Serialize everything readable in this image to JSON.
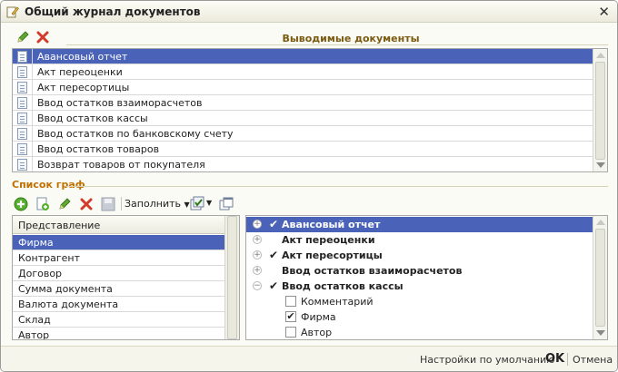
{
  "window": {
    "title": "Общий журнал документов",
    "close_glyph": "✕"
  },
  "docs": {
    "caption": "Выводимые документы",
    "items": [
      {
        "label": "Авансовый отчет",
        "selected": true
      },
      {
        "label": "Акт переоценки"
      },
      {
        "label": "Акт пересортицы"
      },
      {
        "label": "Ввод остатков взаиморасчетов"
      },
      {
        "label": "Ввод остатков кассы"
      },
      {
        "label": "Ввод остатков по банковскому счету"
      },
      {
        "label": "Ввод остатков товаров"
      },
      {
        "label": "Возврат товаров от покупателя"
      }
    ]
  },
  "columns": {
    "caption": "Список граф",
    "fill_label": "Заполнить",
    "fields_header": "Представление",
    "fields": [
      "Фирма",
      "Контрагент",
      "Договор",
      "Сумма документа",
      "Валюта документа",
      "Склад",
      "Автор"
    ],
    "tree": [
      {
        "label": "Авансовый отчет",
        "expander": "+",
        "checked": true,
        "selected": true
      },
      {
        "label": "Акт переоценки",
        "expander": "+",
        "checked": false
      },
      {
        "label": "Акт пересортицы",
        "expander": "+",
        "checked": true
      },
      {
        "label": "Ввод остатков взаиморасчетов",
        "expander": "+",
        "checked": false
      },
      {
        "label": "Ввод остатков кассы",
        "expander": "−",
        "checked": true
      },
      {
        "label": "Комментарий",
        "child": true,
        "checked": false
      },
      {
        "label": "Фирма",
        "child": true,
        "checked": true
      },
      {
        "label": "Автор",
        "child": true,
        "checked": false
      }
    ]
  },
  "footer": {
    "defaults_label": "Настройки по умолчанию",
    "ok_label": "OK",
    "cancel_label": "Отмена"
  },
  "icons": {
    "edit": "pencil-icon",
    "delete": "red-x-icon",
    "add": "green-plus-icon",
    "copy": "copy-icon",
    "save": "disk-icon",
    "check_all": "check-list-icon",
    "windows": "windows-icon"
  }
}
